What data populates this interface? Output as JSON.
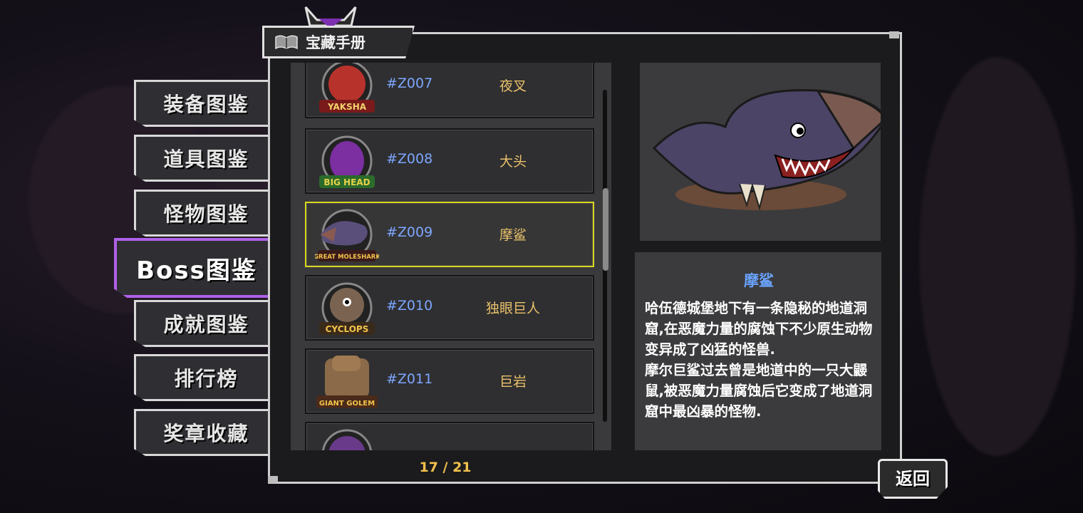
{
  "header": {
    "title": "宝藏手册",
    "book_icon": "open-book-icon"
  },
  "sidebar": {
    "items": [
      {
        "label": "装备图鉴",
        "active": false
      },
      {
        "label": "道具图鉴",
        "active": false
      },
      {
        "label": "怪物图鉴",
        "active": false
      },
      {
        "label": "Boss图鉴",
        "active": true
      },
      {
        "label": "成就图鉴",
        "active": false
      },
      {
        "label": "排行榜",
        "active": false
      },
      {
        "label": "奖章收藏",
        "active": false
      }
    ]
  },
  "list": {
    "rows": [
      {
        "code": "#Z007",
        "name": "夜叉",
        "badge": "YAKSHA",
        "color": "#b8322c",
        "selected": false
      },
      {
        "code": "#Z008",
        "name": "大头",
        "badge": "BIG HEAD",
        "color": "#7b2fa0",
        "selected": false
      },
      {
        "code": "#Z009",
        "name": "摩鲨",
        "badge": "GREAT MOLESHARK",
        "color": "#5a4f7a",
        "selected": true
      },
      {
        "code": "#Z010",
        "name": "独眼巨人",
        "badge": "CYCLOPS",
        "color": "#7a6350",
        "selected": false
      },
      {
        "code": "#Z011",
        "name": "巨岩",
        "badge": "GIANT GOLEM",
        "color": "#8a6a48",
        "selected": false
      }
    ],
    "page_counter": "17 / 21"
  },
  "detail": {
    "name": "摩鲨",
    "paragraph1": "哈伍德城堡地下有一条隐秘的地道洞窟,在恶魔力量的腐蚀下不少原生动物变异成了凶猛的怪兽.",
    "paragraph2": "摩尔巨鲨过去曾是地道中的一只大鼹鼠,被恶魔力量腐蚀后它变成了地道洞窟中最凶暴的怪物."
  },
  "back_button": {
    "label": "返回"
  },
  "colors": {
    "accent_active": "#b060e8",
    "selected_border": "#d9d51e",
    "code_blue": "#7da6ff",
    "name_gold": "#e9c16a"
  }
}
